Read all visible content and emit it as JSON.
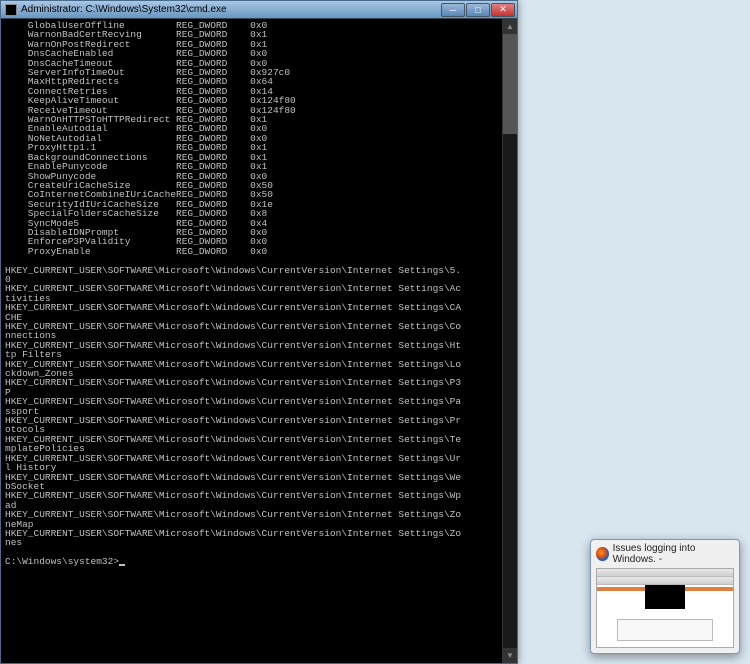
{
  "titlebar": {
    "title": "Administrator: C:\\Windows\\System32\\cmd.exe"
  },
  "preview": {
    "title": "Issues logging into Windows. -"
  },
  "console": {
    "reg_values": [
      {
        "name": "GlobalUserOffline",
        "type": "REG_DWORD",
        "value": "0x0"
      },
      {
        "name": "WarnonBadCertRecving",
        "type": "REG_DWORD",
        "value": "0x1"
      },
      {
        "name": "WarnOnPostRedirect",
        "type": "REG_DWORD",
        "value": "0x1"
      },
      {
        "name": "DnsCacheEnabled",
        "type": "REG_DWORD",
        "value": "0x0"
      },
      {
        "name": "DnsCacheTimeout",
        "type": "REG_DWORD",
        "value": "0x0"
      },
      {
        "name": "ServerInfoTimeOut",
        "type": "REG_DWORD",
        "value": "0x927c0"
      },
      {
        "name": "MaxHttpRedirects",
        "type": "REG_DWORD",
        "value": "0x64"
      },
      {
        "name": "ConnectRetries",
        "type": "REG_DWORD",
        "value": "0x14"
      },
      {
        "name": "KeepAliveTimeout",
        "type": "REG_DWORD",
        "value": "0x124f80"
      },
      {
        "name": "ReceiveTimeout",
        "type": "REG_DWORD",
        "value": "0x124f80"
      },
      {
        "name": "WarnOnHTTPSToHTTPRedirect",
        "type": "REG_DWORD",
        "value": "0x1"
      },
      {
        "name": "EnableAutodial",
        "type": "REG_DWORD",
        "value": "0x0"
      },
      {
        "name": "NoNetAutodial",
        "type": "REG_DWORD",
        "value": "0x0"
      },
      {
        "name": "ProxyHttp1.1",
        "type": "REG_DWORD",
        "value": "0x1"
      },
      {
        "name": "BackgroundConnections",
        "type": "REG_DWORD",
        "value": "0x1"
      },
      {
        "name": "EnablePunycode",
        "type": "REG_DWORD",
        "value": "0x1"
      },
      {
        "name": "ShowPunycode",
        "type": "REG_DWORD",
        "value": "0x0"
      },
      {
        "name": "CreateUriCacheSize",
        "type": "REG_DWORD",
        "value": "0x50"
      },
      {
        "name": "CoInternetCombineIUriCacheSize",
        "type": "REG_DWORD",
        "value": "0x50"
      },
      {
        "name": "SecurityIdIUriCacheSize",
        "type": "REG_DWORD",
        "value": "0x1e"
      },
      {
        "name": "SpecialFoldersCacheSize",
        "type": "REG_DWORD",
        "value": "0x8"
      },
      {
        "name": "SyncMode5",
        "type": "REG_DWORD",
        "value": "0x4"
      },
      {
        "name": "DisableIDNPrompt",
        "type": "REG_DWORD",
        "value": "0x0"
      },
      {
        "name": "EnforceP3PValidity",
        "type": "REG_DWORD",
        "value": "0x0"
      },
      {
        "name": "ProxyEnable",
        "type": "REG_DWORD",
        "value": "0x0"
      }
    ],
    "reg_keys": [
      "HKEY_CURRENT_USER\\SOFTWARE\\Microsoft\\Windows\\CurrentVersion\\Internet Settings\\5.0",
      "HKEY_CURRENT_USER\\SOFTWARE\\Microsoft\\Windows\\CurrentVersion\\Internet Settings\\Activities",
      "HKEY_CURRENT_USER\\SOFTWARE\\Microsoft\\Windows\\CurrentVersion\\Internet Settings\\CACHE",
      "HKEY_CURRENT_USER\\SOFTWARE\\Microsoft\\Windows\\CurrentVersion\\Internet Settings\\Connections",
      "HKEY_CURRENT_USER\\SOFTWARE\\Microsoft\\Windows\\CurrentVersion\\Internet Settings\\Http Filters",
      "HKEY_CURRENT_USER\\SOFTWARE\\Microsoft\\Windows\\CurrentVersion\\Internet Settings\\Lockdown_Zones",
      "HKEY_CURRENT_USER\\SOFTWARE\\Microsoft\\Windows\\CurrentVersion\\Internet Settings\\P3P",
      "HKEY_CURRENT_USER\\SOFTWARE\\Microsoft\\Windows\\CurrentVersion\\Internet Settings\\Passport",
      "HKEY_CURRENT_USER\\SOFTWARE\\Microsoft\\Windows\\CurrentVersion\\Internet Settings\\Protocols",
      "HKEY_CURRENT_USER\\SOFTWARE\\Microsoft\\Windows\\CurrentVersion\\Internet Settings\\TemplatePolicies",
      "HKEY_CURRENT_USER\\SOFTWARE\\Microsoft\\Windows\\CurrentVersion\\Internet Settings\\Url History",
      "HKEY_CURRENT_USER\\SOFTWARE\\Microsoft\\Windows\\CurrentVersion\\Internet Settings\\WebSocket",
      "HKEY_CURRENT_USER\\SOFTWARE\\Microsoft\\Windows\\CurrentVersion\\Internet Settings\\Wpad",
      "HKEY_CURRENT_USER\\SOFTWARE\\Microsoft\\Windows\\CurrentVersion\\Internet Settings\\ZoneMap",
      "HKEY_CURRENT_USER\\SOFTWARE\\Microsoft\\Windows\\CurrentVersion\\Internet Settings\\Zones"
    ],
    "prompt": "C:\\Windows\\system32>"
  }
}
